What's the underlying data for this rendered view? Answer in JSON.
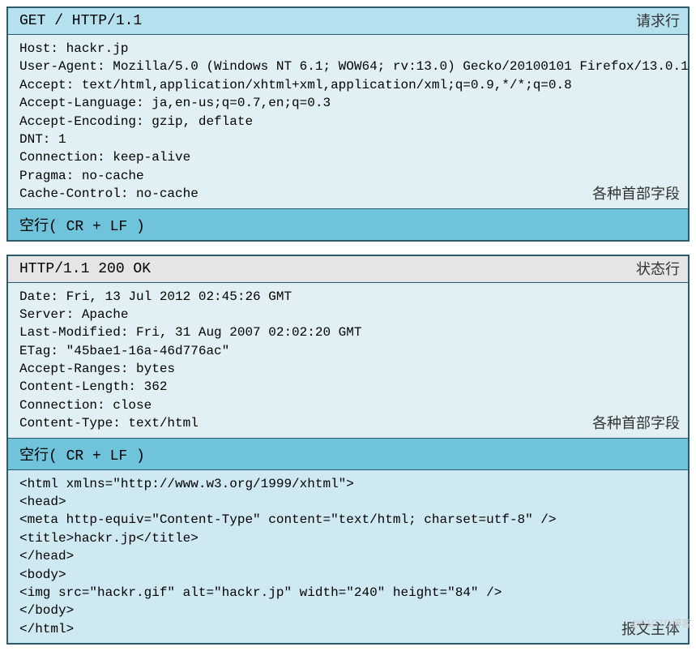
{
  "request": {
    "request_line": "GET / HTTP/1.1",
    "request_line_label": "请求行",
    "headers": "Host: hackr.jp\nUser-Agent: Mozilla/5.0 (Windows NT 6.1; WOW64; rv:13.0) Gecko/20100101 Firefox/13.0.1\nAccept: text/html,application/xhtml+xml,application/xml;q=0.9,*/*;q=0.8\nAccept-Language: ja,en-us;q=0.7,en;q=0.3\nAccept-Encoding: gzip, deflate\nDNT: 1\nConnection: keep-alive\nPragma: no-cache\nCache-Control: no-cache",
    "headers_label": "各种首部字段",
    "blank_line": "空行( CR + LF )"
  },
  "response": {
    "status_line": "HTTP/1.1 200 OK",
    "status_line_label": "状态行",
    "headers": "Date: Fri, 13 Jul 2012 02:45:26 GMT\nServer: Apache\nLast-Modified: Fri, 31 Aug 2007 02:02:20 GMT\nETag: \"45bae1-16a-46d776ac\"\nAccept-Ranges: bytes\nContent-Length: 362\nConnection: close\nContent-Type: text/html",
    "headers_label": "各种首部字段",
    "blank_line": "空行( CR + LF )",
    "body": "<html xmlns=\"http://www.w3.org/1999/xhtml\">\n<head>\n<meta http-equiv=\"Content-Type\" content=\"text/html; charset=utf-8\" />\n<title>hackr.jp</title>\n</head>\n<body>\n<img src=\"hackr.gif\" alt=\"hackr.jp\" width=\"240\" height=\"84\" />\n</body>\n</html>",
    "body_label": "报文主体"
  },
  "watermark": "@51CTO博客"
}
